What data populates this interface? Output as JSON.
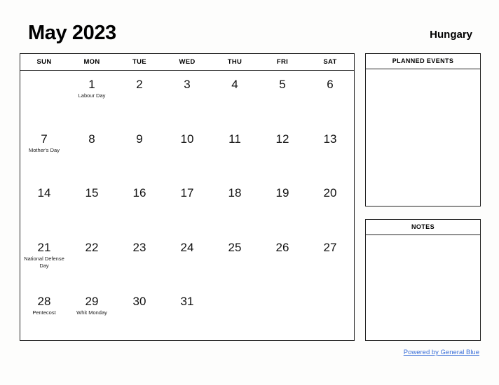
{
  "header": {
    "title": "May 2023",
    "country": "Hungary"
  },
  "calendar": {
    "weekdays": [
      "SUN",
      "MON",
      "TUE",
      "WED",
      "THU",
      "FRI",
      "SAT"
    ],
    "weeks": [
      [
        {
          "day": "",
          "event": ""
        },
        {
          "day": "1",
          "event": "Labour Day"
        },
        {
          "day": "2",
          "event": ""
        },
        {
          "day": "3",
          "event": ""
        },
        {
          "day": "4",
          "event": ""
        },
        {
          "day": "5",
          "event": ""
        },
        {
          "day": "6",
          "event": ""
        }
      ],
      [
        {
          "day": "7",
          "event": "Mother's Day"
        },
        {
          "day": "8",
          "event": ""
        },
        {
          "day": "9",
          "event": ""
        },
        {
          "day": "10",
          "event": ""
        },
        {
          "day": "11",
          "event": ""
        },
        {
          "day": "12",
          "event": ""
        },
        {
          "day": "13",
          "event": ""
        }
      ],
      [
        {
          "day": "14",
          "event": ""
        },
        {
          "day": "15",
          "event": ""
        },
        {
          "day": "16",
          "event": ""
        },
        {
          "day": "17",
          "event": ""
        },
        {
          "day": "18",
          "event": ""
        },
        {
          "day": "19",
          "event": ""
        },
        {
          "day": "20",
          "event": ""
        }
      ],
      [
        {
          "day": "21",
          "event": "National Defense Day"
        },
        {
          "day": "22",
          "event": ""
        },
        {
          "day": "23",
          "event": ""
        },
        {
          "day": "24",
          "event": ""
        },
        {
          "day": "25",
          "event": ""
        },
        {
          "day": "26",
          "event": ""
        },
        {
          "day": "27",
          "event": ""
        }
      ],
      [
        {
          "day": "28",
          "event": "Pentecost"
        },
        {
          "day": "29",
          "event": "Whit Monday"
        },
        {
          "day": "30",
          "event": ""
        },
        {
          "day": "31",
          "event": ""
        },
        {
          "day": "",
          "event": ""
        },
        {
          "day": "",
          "event": ""
        },
        {
          "day": "",
          "event": ""
        }
      ]
    ]
  },
  "panels": {
    "planned_events": {
      "title": "PLANNED EVENTS",
      "content": ""
    },
    "notes": {
      "title": "NOTES",
      "content": ""
    }
  },
  "footer": {
    "link_label": "Powered by General Blue"
  },
  "colors": {
    "link": "#3a6fd8",
    "border": "#222222",
    "text": "#111111",
    "background": "#fdfdfc"
  }
}
